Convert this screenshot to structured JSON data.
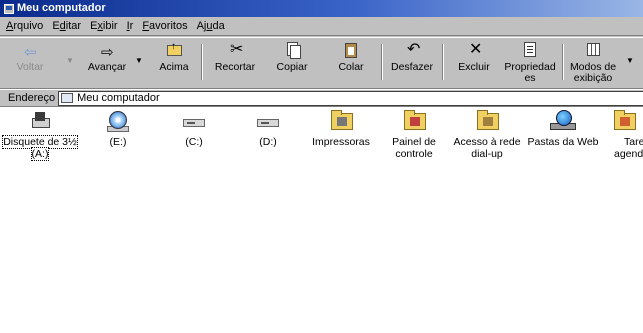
{
  "window": {
    "title": "Meu computador"
  },
  "menu": [
    {
      "pre": "",
      "acc": "A",
      "post": "rquivo"
    },
    {
      "pre": "E",
      "acc": "d",
      "post": "itar"
    },
    {
      "pre": "E",
      "acc": "x",
      "post": "ibir"
    },
    {
      "pre": "",
      "acc": "I",
      "post": "r"
    },
    {
      "pre": "",
      "acc": "F",
      "post": "avoritos"
    },
    {
      "pre": "Aj",
      "acc": "u",
      "post": "da"
    }
  ],
  "toolbar": {
    "back": "Voltar",
    "forward": "Avançar",
    "up": "Acima",
    "cut": "Recortar",
    "copy": "Copiar",
    "paste": "Colar",
    "undo": "Desfazer",
    "delete": "Excluir",
    "properties_1": "Propriedad",
    "properties_2": "es",
    "views_1": "Modos de",
    "views_2": "exibição"
  },
  "address": {
    "label": "Endereço",
    "value": "Meu computador"
  },
  "items": [
    {
      "line1": "Disquete de 3½",
      "line2": "(A:)",
      "icon": "floppy-drive-icon"
    },
    {
      "line1": "(E:)",
      "line2": "",
      "icon": "cd-drive-icon"
    },
    {
      "line1": "(C:)",
      "line2": "",
      "icon": "hard-drive-icon"
    },
    {
      "line1": "(D:)",
      "line2": "",
      "icon": "hard-drive-icon"
    },
    {
      "line1": "Impressoras",
      "line2": "",
      "icon": "printers-folder-icon"
    },
    {
      "line1": "Painel de",
      "line2": "controle",
      "icon": "control-panel-folder-icon"
    },
    {
      "line1": "Acesso à rede",
      "line2": "dial-up",
      "icon": "dialup-folder-icon"
    },
    {
      "line1": "Pastas da Web",
      "line2": "",
      "icon": "web-folders-icon"
    },
    {
      "line1": "Tare",
      "line2": "agend",
      "icon": "scheduled-tasks-folder-icon"
    }
  ]
}
